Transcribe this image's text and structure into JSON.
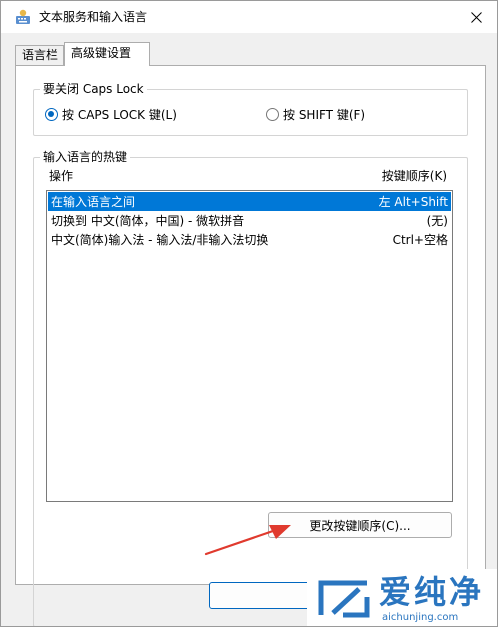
{
  "window": {
    "title": "文本服务和输入语言"
  },
  "tabs": [
    {
      "label": "语言栏"
    },
    {
      "label": "高级键设置"
    }
  ],
  "caps_lock": {
    "group_title": "要关闭 Caps Lock",
    "options": [
      {
        "label": "按 CAPS LOCK 键(L)",
        "checked": true
      },
      {
        "label": "按 SHIFT 键(F)",
        "checked": false
      }
    ]
  },
  "hotkeys": {
    "group_title": "输入语言的热键",
    "col_action": "操作",
    "col_sequence": "按键顺序(K)",
    "rows": [
      {
        "action": "在输入语言之间",
        "sequence": "左 Alt+Shift",
        "selected": true
      },
      {
        "action": "切换到 中文(简体，中国) - 微软拼音",
        "sequence": "(无)",
        "selected": false
      },
      {
        "action": "中文(简体)输入法 - 输入法/非输入法切换",
        "sequence": "Ctrl+空格",
        "selected": false
      }
    ],
    "change_button": "更改按键顺序(C)..."
  },
  "watermark": {
    "brand": "爱纯净",
    "url": "aichunjing.com"
  },
  "colors": {
    "accent": "#0078d7",
    "arrow": "#e03a2e",
    "brand": "#2a75bf"
  }
}
